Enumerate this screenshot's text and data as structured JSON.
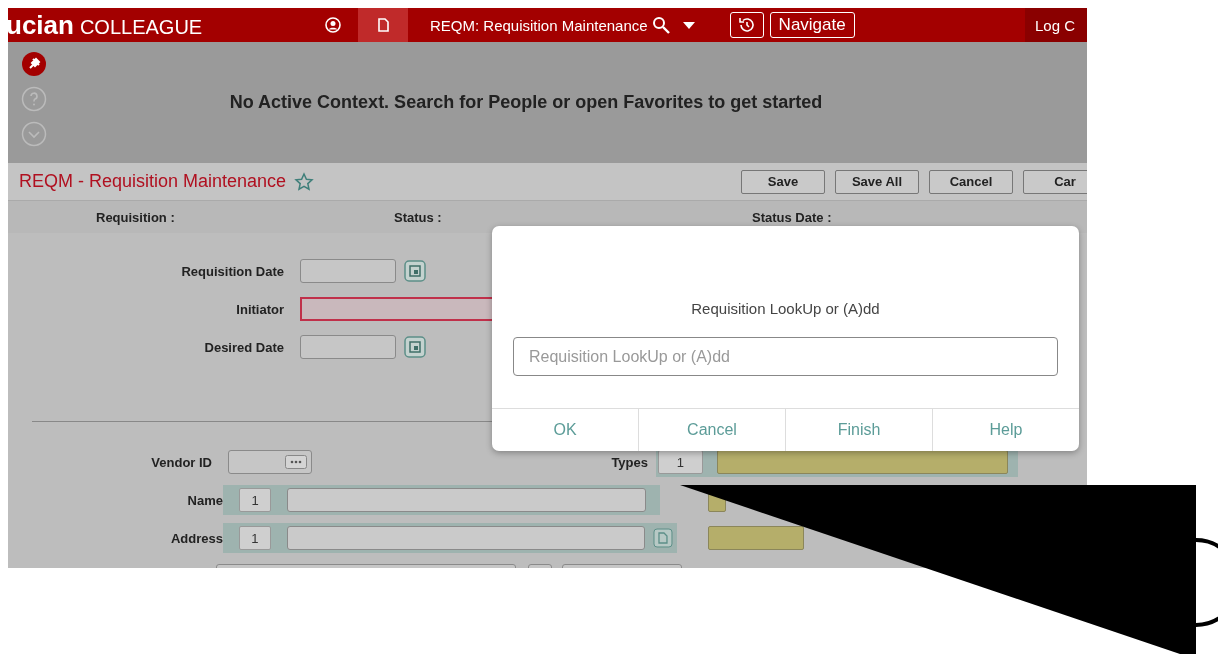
{
  "header": {
    "brand_partial": "ucian",
    "brand": "COLLEAGUE",
    "tabs": [
      {
        "kind": "person",
        "selected": false
      },
      {
        "kind": "document",
        "selected": true
      }
    ],
    "current_form": "REQM: Requisition Maintenance",
    "navigate": "Navigate",
    "logout": "Log C"
  },
  "context": {
    "message": "No Active Context. Search for People or open Favorites to get started"
  },
  "form": {
    "title": "REQM - Requisition Maintenance",
    "buttons": [
      "Save",
      "Save All",
      "Cancel",
      "Car"
    ],
    "info_labels": [
      "Requisition :",
      "Status :",
      "Status Date :"
    ],
    "fields": [
      {
        "label": "Requisition Date",
        "kind": "date",
        "required": false
      },
      {
        "label": "Initiator",
        "kind": "text",
        "required": true
      },
      {
        "label": "Desired Date",
        "kind": "date",
        "required": false
      }
    ],
    "vendor_id": {
      "label": "Vendor ID"
    },
    "types": {
      "label": "Types",
      "value": "1"
    },
    "name": {
      "label": "Name",
      "value": "1"
    },
    "address": {
      "label": "Address",
      "value": "1"
    }
  },
  "dialog": {
    "prompt": "Requisition LookUp or (A)dd",
    "placeholder": "Requisition LookUp or (A)dd",
    "buttons": [
      "OK",
      "Cancel",
      "Finish",
      "Help"
    ]
  }
}
